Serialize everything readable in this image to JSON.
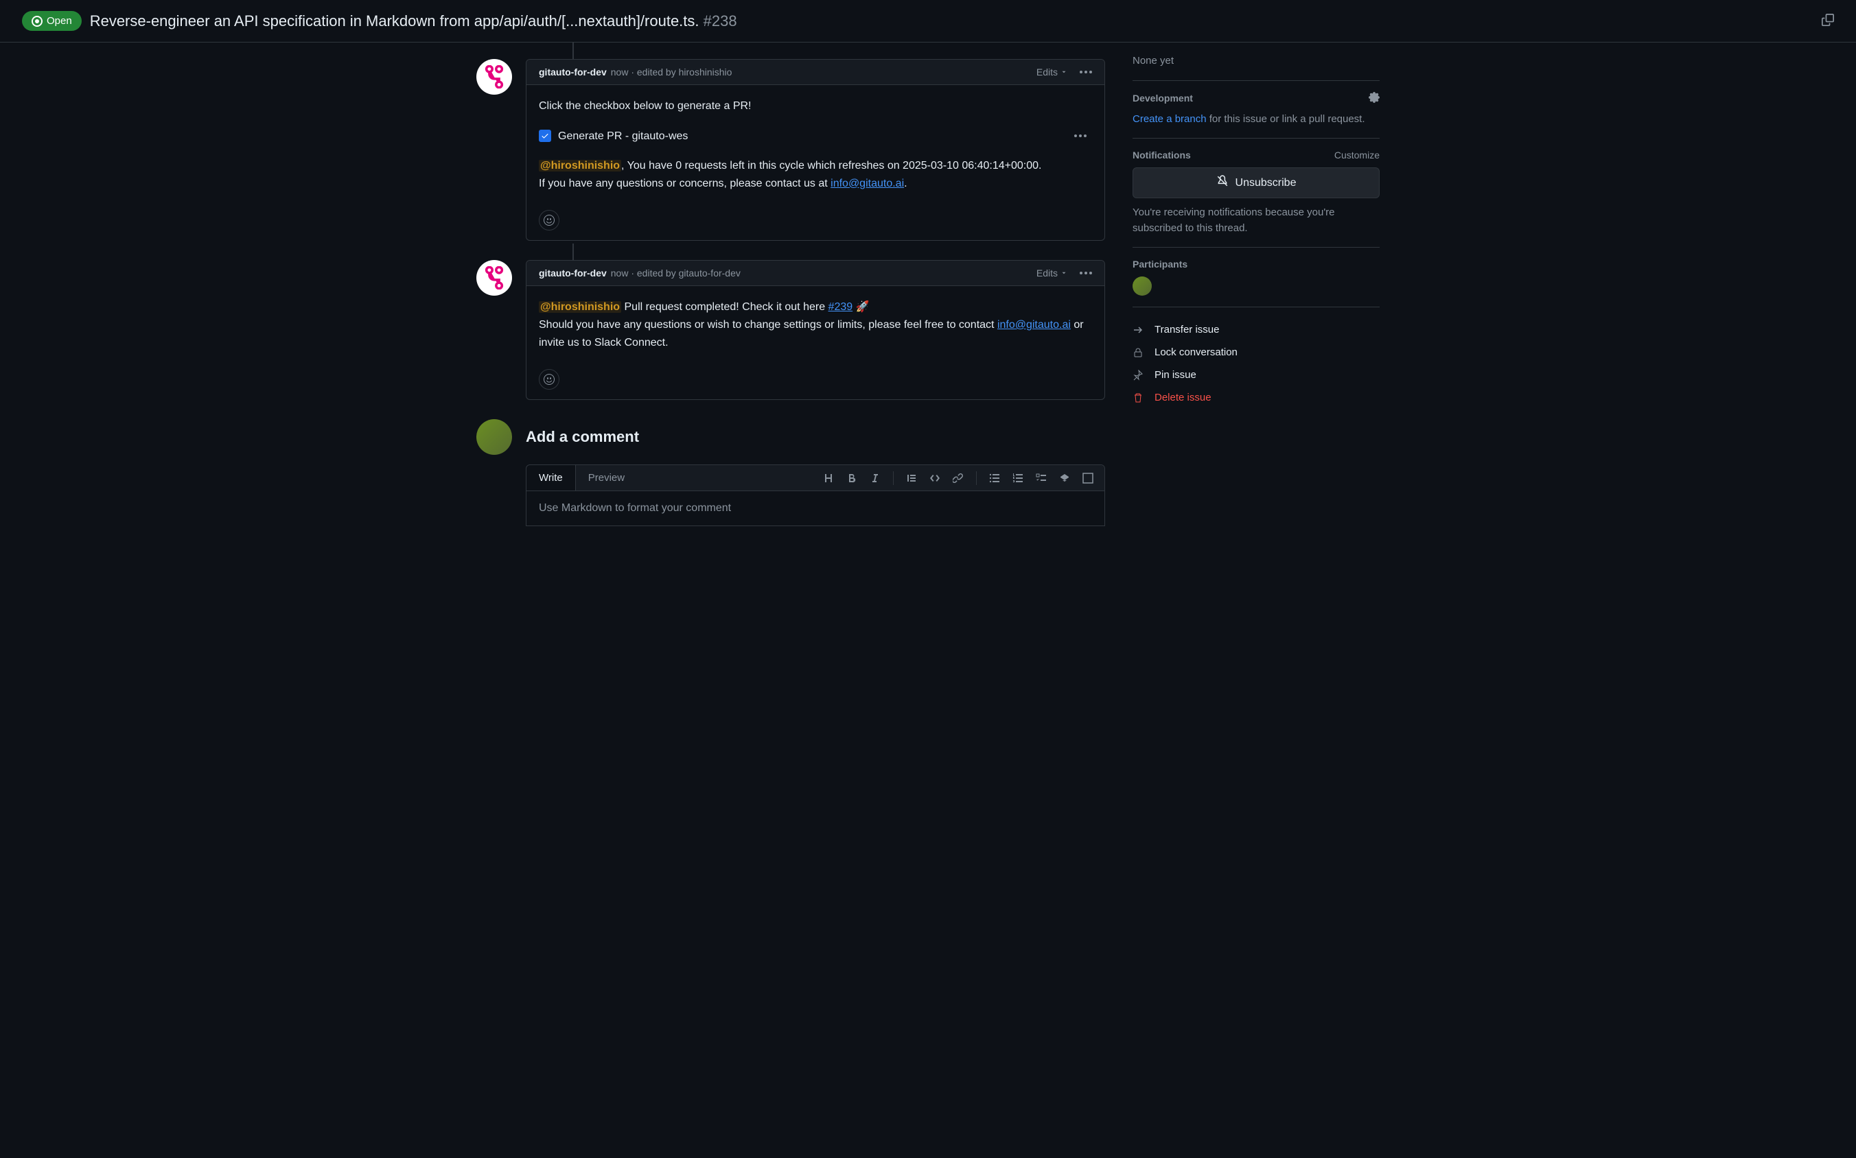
{
  "header": {
    "status": "Open",
    "title": "Reverse-engineer an API specification in Markdown from app/api/auth/[...nextauth]/route.ts.",
    "issue_number": "#238"
  },
  "comments": [
    {
      "author": "gitauto-for-dev",
      "time": "now",
      "edited_by": "hiroshinishio",
      "edits_label": "Edits",
      "body_intro": "Click the checkbox below to generate a PR!",
      "task_label": "Generate PR - gitauto-wes",
      "mention": "@hiroshinishio",
      "quota_text": ", You have 0 requests left in this cycle which refreshes on 2025-03-10 06:40:14+00:00.",
      "contact_prefix": "If you have any questions or concerns, please contact us at ",
      "contact_email": "info@gitauto.ai",
      "contact_suffix": "."
    },
    {
      "author": "gitauto-for-dev",
      "time": "now",
      "edited_by": "gitauto-for-dev",
      "edits_label": "Edits",
      "mention": "@hiroshinishio",
      "pr_text_prefix": " Pull request completed! Check it out here ",
      "pr_link": "#239",
      "pr_emoji": " 🚀",
      "followup_prefix": "Should you have any questions or wish to change settings or limits, please feel free to contact ",
      "followup_email": "info@gitauto.ai",
      "followup_suffix": " or invite us to Slack Connect."
    }
  ],
  "add_comment": {
    "heading": "Add a comment",
    "tab_write": "Write",
    "tab_preview": "Preview",
    "placeholder": "Use Markdown to format your comment"
  },
  "sidebar": {
    "none_yet": "None yet",
    "development": {
      "heading": "Development",
      "link": "Create a branch",
      "text": " for this issue or link a pull request."
    },
    "notifications": {
      "heading": "Notifications",
      "customize": "Customize",
      "button": "Unsubscribe",
      "text": "You're receiving notifications because you're subscribed to this thread."
    },
    "participants": {
      "heading": "Participants"
    },
    "actions": {
      "transfer": "Transfer issue",
      "lock": "Lock conversation",
      "pin": "Pin issue",
      "delete": "Delete issue"
    }
  }
}
